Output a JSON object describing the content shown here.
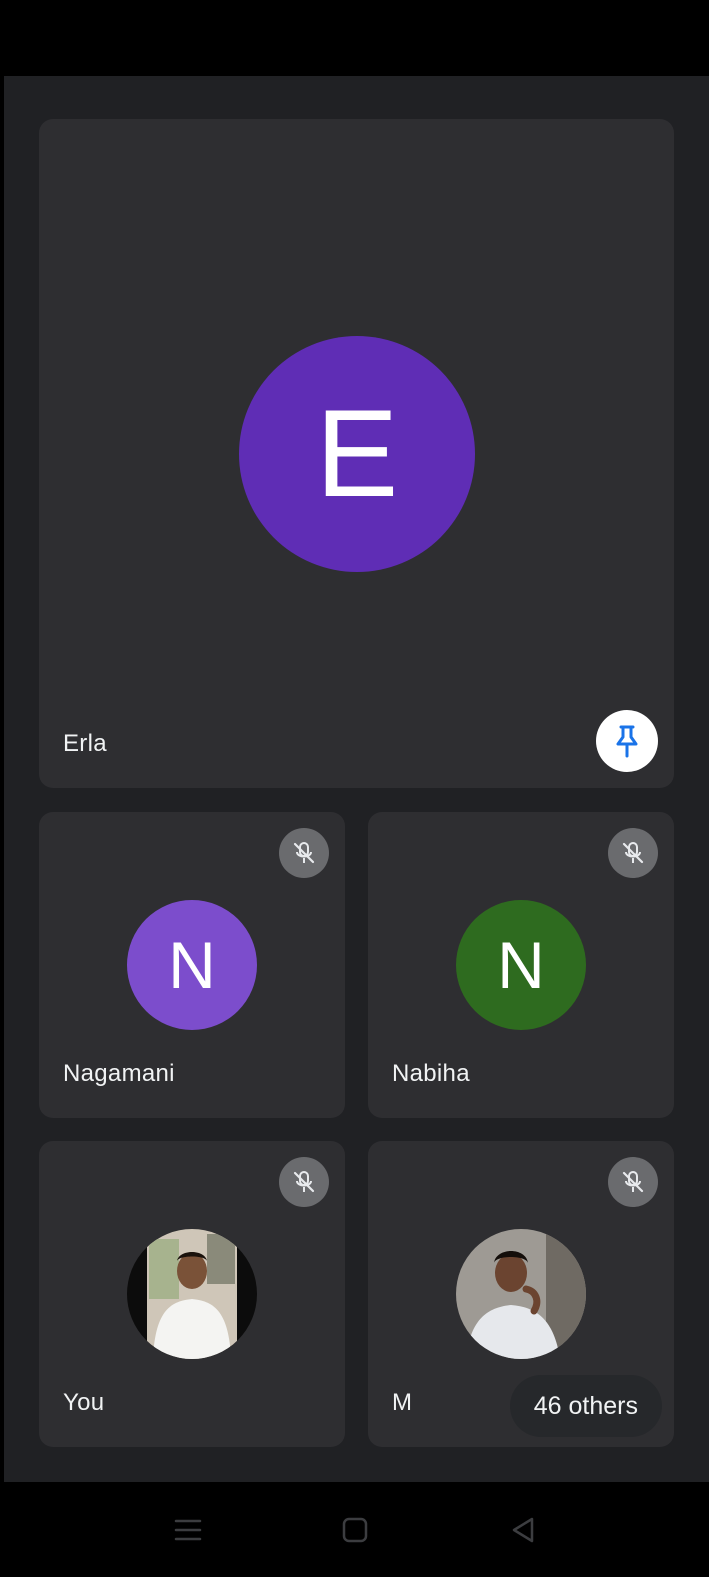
{
  "main_participant": {
    "name": "Erla",
    "initial": "E",
    "avatar_color": "#5f2db5",
    "pin_icon": "pin-icon"
  },
  "participants": [
    {
      "name": "Nagamani",
      "initial": "N",
      "avatar_color": "#7c4dcc",
      "muted": true
    },
    {
      "name": "Nabiha",
      "initial": "N",
      "avatar_color": "#2e6b1f",
      "muted": true
    },
    {
      "name": "You",
      "avatar": "photo",
      "muted": true
    },
    {
      "name": "M",
      "avatar": "photo",
      "muted": true
    }
  ],
  "others_label": "46 others",
  "nav": {
    "recent_icon": "recent-apps-icon",
    "home_icon": "home-icon",
    "back_icon": "back-icon"
  },
  "colors": {
    "background": "#202124",
    "tile": "#2e2e31",
    "mute_badge": "#6a6b6e",
    "pin_accent": "#1a73e8"
  }
}
